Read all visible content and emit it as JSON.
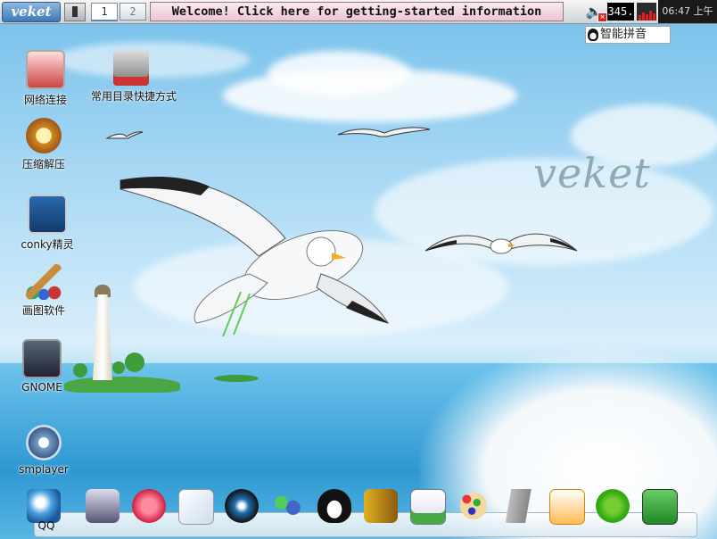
{
  "taskbar": {
    "logo": "veket",
    "workspaces": [
      "1",
      "2"
    ],
    "notice": "Welcome! Click here for getting-started information",
    "cpu": "345.",
    "clock": "06:47 上午",
    "ime": "智能拼音"
  },
  "wallpaper": {
    "watermark": "veket"
  },
  "desktop_icons": [
    {
      "label": "网络连接",
      "icon": "network-monitor-icon"
    },
    {
      "label": "常用目录快捷方式",
      "icon": "folder-shortcut-icon"
    },
    {
      "label": "压缩解压",
      "icon": "archive-icon"
    },
    {
      "label": "conky精灵",
      "icon": "system-monitor-icon"
    },
    {
      "label": "画图软件",
      "icon": "paint-brush-icon"
    },
    {
      "label": "GNOME",
      "icon": "gnome-mplayer-icon"
    },
    {
      "label": "smplayer",
      "icon": "smplayer-icon"
    }
  ],
  "dock": {
    "first_label": "QQ",
    "items": [
      "qq-icon",
      "monitor-icon",
      "pet-icon",
      "notepad-icon",
      "media-icon",
      "users-icon",
      "penguin-icon",
      "files-icon",
      "chart-icon",
      "palette-icon",
      "usb-icon",
      "game-icon",
      "help-icon",
      "camera-icon"
    ]
  },
  "colors": {
    "notice_bg": "#ecc7d3",
    "clock_bg": "#1a1a1a",
    "mem_bar": "#e02020"
  }
}
